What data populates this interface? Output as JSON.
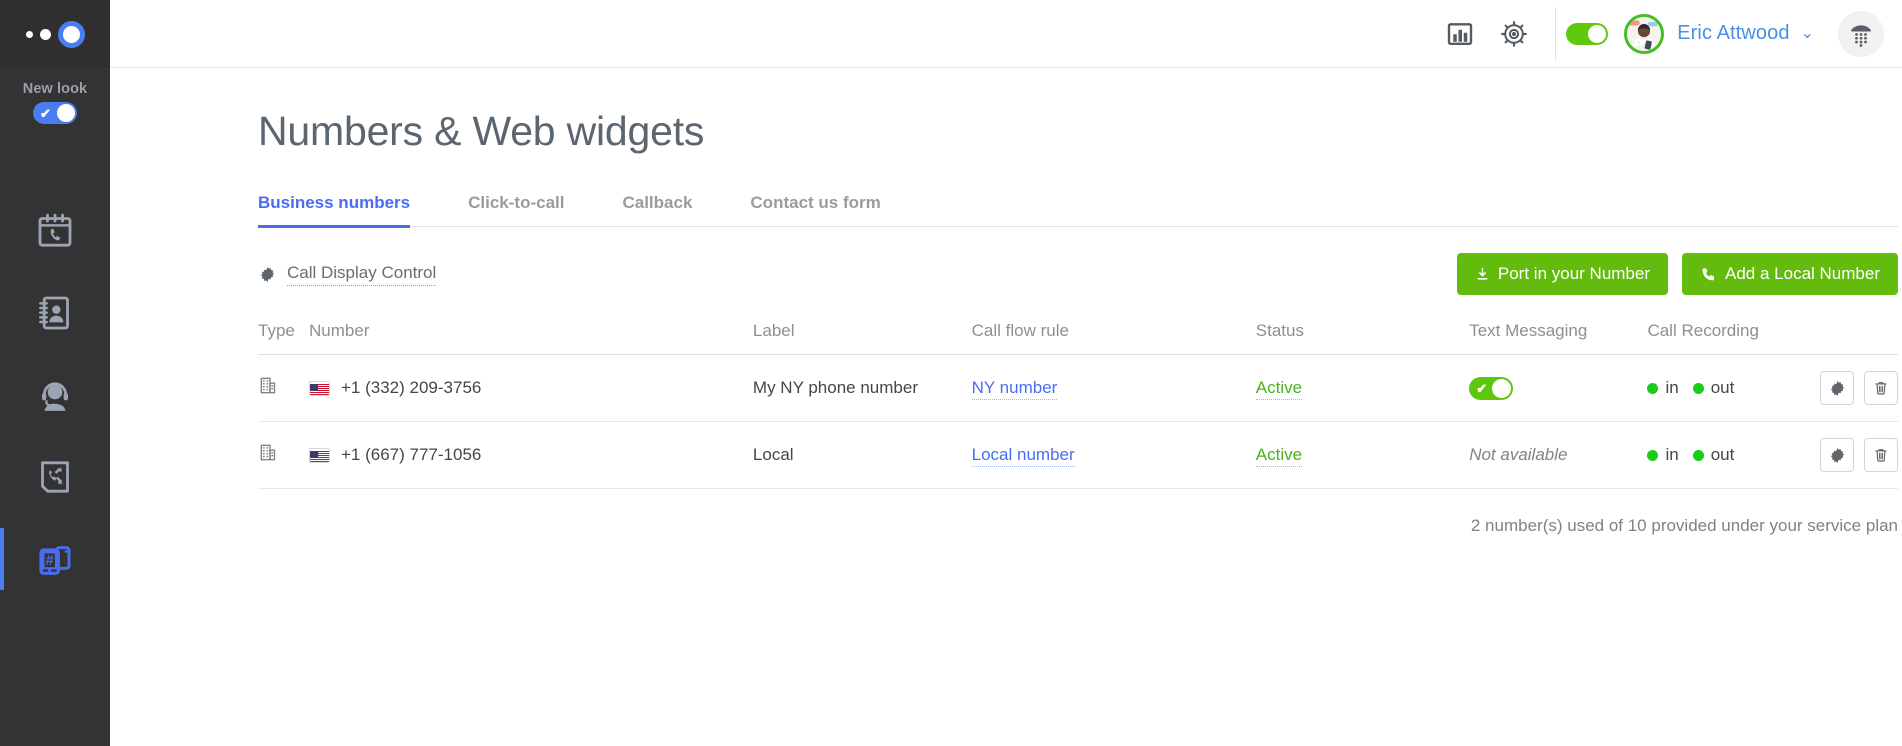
{
  "sidebar": {
    "logo_name": "app-logo",
    "new_look": {
      "label": "New look",
      "enabled": true,
      "check": "✔"
    },
    "items": [
      {
        "name": "call-history",
        "icon": "calendar-phone-icon",
        "active": false
      },
      {
        "name": "contacts",
        "icon": "address-book-icon",
        "active": false
      },
      {
        "name": "agents",
        "icon": "headset-agent-icon",
        "active": false
      },
      {
        "name": "call-flows",
        "icon": "call-flow-icon",
        "active": false
      },
      {
        "name": "numbers",
        "icon": "phone-numbers-icon",
        "active": true
      }
    ]
  },
  "topbar": {
    "stats_icon": "bar-chart-icon",
    "settings_icon": "gear-icon",
    "availability_toggle": {
      "name": "availability-toggle",
      "enabled": true
    },
    "user": {
      "name": "Eric Attwood",
      "avatar": "user-avatar",
      "chevron": "⌄"
    },
    "dialpad_icon": "dialpad-icon"
  },
  "page": {
    "title": "Numbers & Web widgets"
  },
  "tabs": [
    {
      "label": "Business numbers",
      "active": true
    },
    {
      "label": "Click-to-call",
      "active": false
    },
    {
      "label": "Callback",
      "active": false
    },
    {
      "label": "Contact us form",
      "active": false
    }
  ],
  "actions": {
    "call_display_control": {
      "label": "Call Display Control",
      "icon": "gear-icon"
    },
    "port_in_button": {
      "label": "Port in your Number",
      "icon": "download-icon"
    },
    "add_local_button": {
      "label": "Add a Local Number",
      "icon": "phone-icon"
    }
  },
  "table": {
    "columns": [
      "Type",
      "Number",
      "Label",
      "Call flow rule",
      "Status",
      "Text Messaging",
      "Call Recording"
    ],
    "rows": [
      {
        "type_icon": "building-icon",
        "flag": "us-flag-icon",
        "number": "+1 (332) 209-3756",
        "label": "My NY phone number",
        "call_flow_rule": "NY number",
        "status": "Active",
        "text_messaging": {
          "type": "toggle",
          "enabled": true,
          "check": "✔"
        },
        "recording": {
          "in_label": "in",
          "out_label": "out",
          "in_on": true,
          "out_on": true
        },
        "settings_icon": "gear-icon",
        "delete_icon": "trash-icon"
      },
      {
        "type_icon": "building-icon",
        "flag": "us-flag-icon",
        "number": "+1 (667) 777-1056",
        "label": "Local",
        "call_flow_rule": "Local number",
        "status": "Active",
        "text_messaging": {
          "type": "text",
          "value": "Not available"
        },
        "recording": {
          "in_label": "in",
          "out_label": "out",
          "in_on": true,
          "out_on": true
        },
        "settings_icon": "gear-icon",
        "delete_icon": "trash-icon"
      }
    ]
  },
  "footer": {
    "note": "2 number(s) used of 10 provided under your service plan"
  },
  "colors": {
    "sidebar_bg": "#333333",
    "accent_blue": "#4a6df0",
    "green_button": "#62bb0d",
    "status_green": "#4caf20",
    "title_gray": "#5c6670"
  }
}
